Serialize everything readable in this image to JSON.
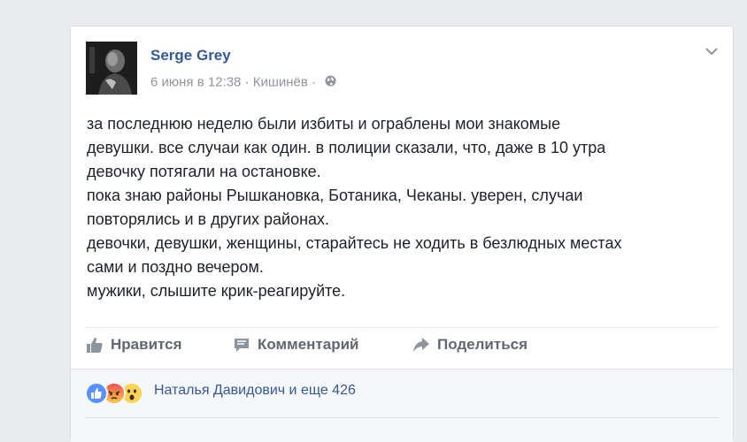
{
  "post": {
    "author": "Serge Grey",
    "date": "6 июня в 12:38",
    "separator": "·",
    "location": "Кишинёв",
    "privacy_icon": "globe-icon",
    "menu_icon": "chevron-down-icon",
    "lines": [
      "за последнюю неделю были избиты и ограблены мои знакомые",
      "девушки. все случаи как один. в полиции сказали, что, даже в 10 утра",
      "девочку потягали на остановке.",
      "пока знаю районы Рышкановка, Ботаника, Чеканы. уверен, случаи",
      "повторялись и в других районах.",
      "девочки, девушки, женщины, старайтесь не ходить в безлюдных местах",
      "сами и поздно вечером.",
      "мужики, слышите крик-реагируйте."
    ]
  },
  "actions": {
    "like_label": "Нравится",
    "comment_label": "Комментарий",
    "share_label": "Поделиться"
  },
  "reactions": {
    "icons": [
      "like-reaction-icon",
      "angry-reaction-icon",
      "wow-reaction-icon"
    ],
    "summary": "Наталья Давидович и еще 426"
  },
  "colors": {
    "link": "#365899",
    "muted": "#90949c",
    "text": "#1d2129",
    "action": "#606770",
    "like_blue": "#5890ff",
    "angry_orange": "#f25268",
    "wow_yellow": "#fcd35a"
  }
}
